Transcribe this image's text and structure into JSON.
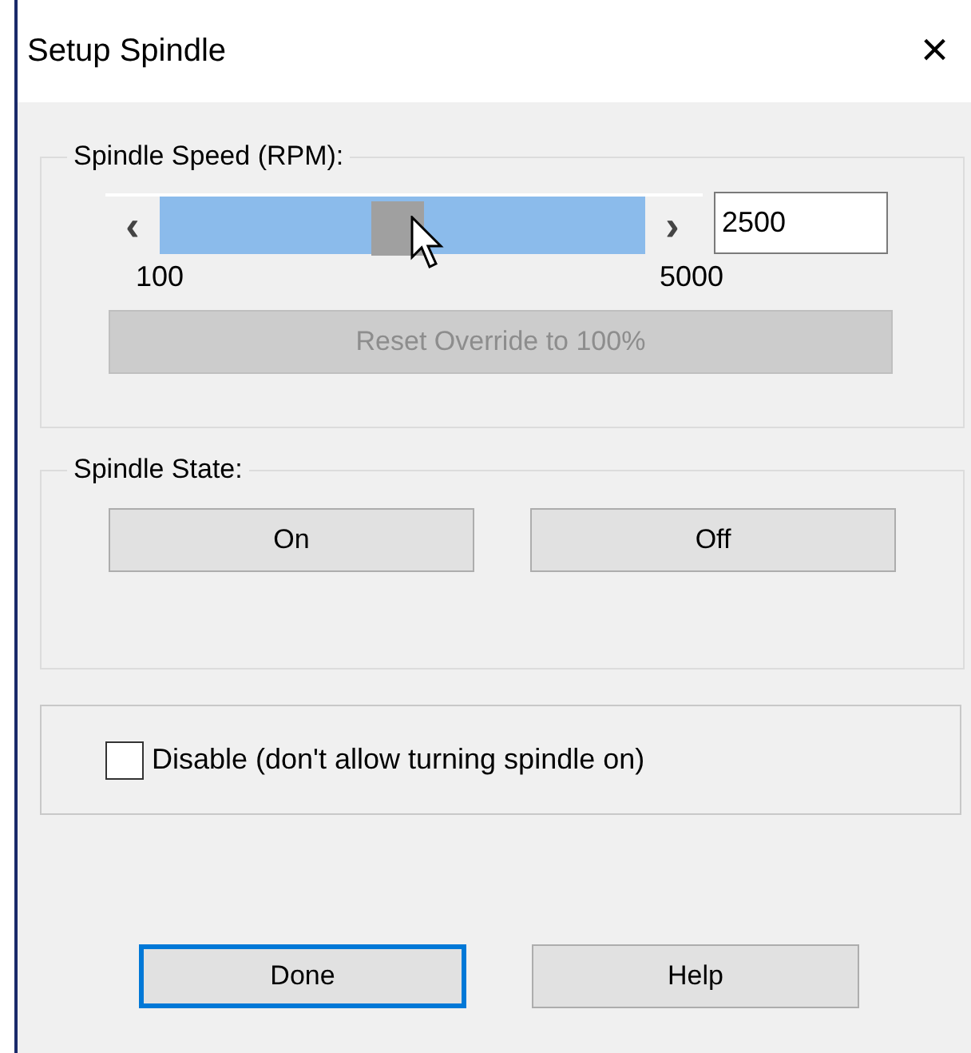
{
  "window": {
    "title": "Setup Spindle",
    "close": "×"
  },
  "speed_group": {
    "legend": "Spindle Speed (RPM):",
    "slider": {
      "left_arrow": "‹",
      "right_arrow": "›",
      "level": 0.49,
      "min_label": "100",
      "max_label": "5000"
    },
    "value": "2500",
    "reset_button": {
      "label": "Reset Override to 100%",
      "disabled": true
    }
  },
  "state_group": {
    "legend": "Spindle State:",
    "buttons": [
      {
        "label": "On"
      },
      {
        "label": "Off"
      }
    ]
  },
  "disable_checkbox": {
    "label": "Disable (don't allow turning spindle on)",
    "checked": false
  },
  "buttons": [
    {
      "label": "Done",
      "focused": true
    },
    {
      "label": "Help",
      "focused": false
    }
  ]
}
